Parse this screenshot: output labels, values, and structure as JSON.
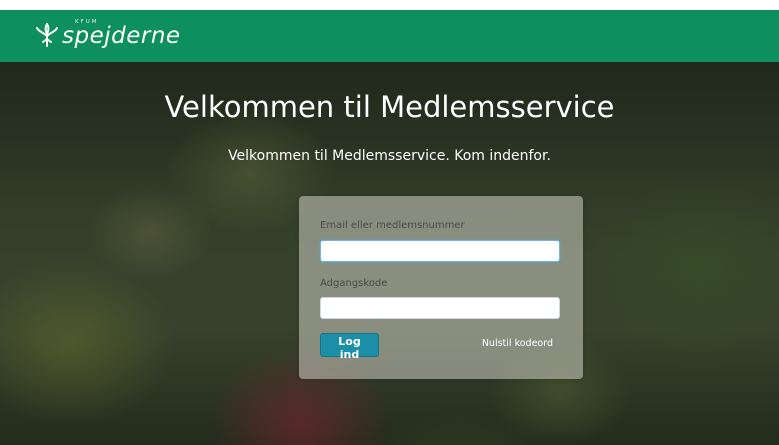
{
  "header": {
    "logo_small": "KFUM",
    "logo_word": "spejderne",
    "background_color": "#0e8f5f"
  },
  "hero": {
    "title": "Velkommen til Medlemsservice",
    "subtitle": "Velkommen til Medlemsservice. Kom indenfor."
  },
  "login": {
    "email_label": "Email eller medlemsnummer",
    "email_value": "",
    "password_label": "Adgangskode",
    "password_value": "",
    "submit_label": "Log ind",
    "reset_label": "Nulstil kodeord",
    "button_color": "#1b8fa7"
  }
}
